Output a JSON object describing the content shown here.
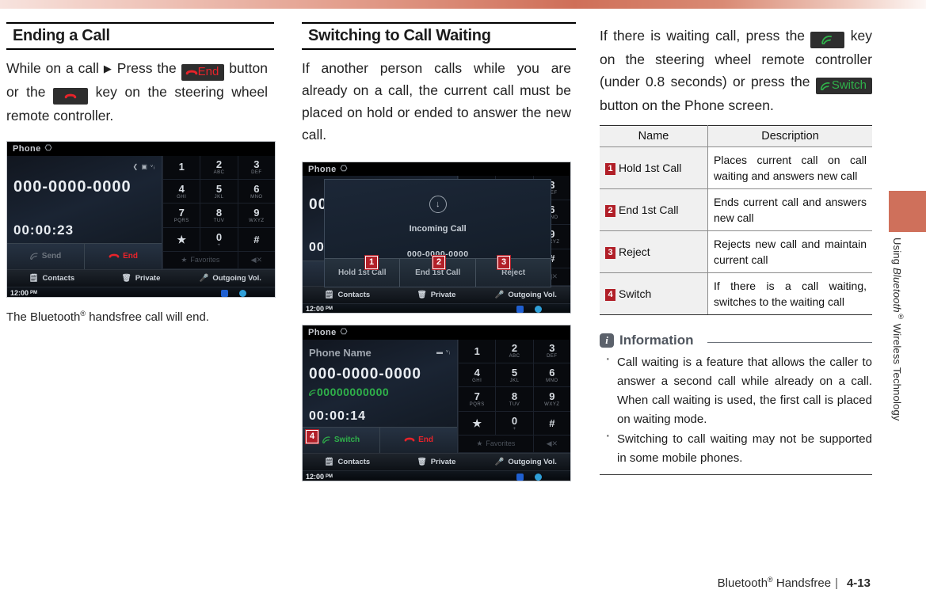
{
  "document": {
    "footer": {
      "chapter_label": "Bluetooth",
      "chapter_label_sup": "®",
      "chapter_label_rest": " Handsfree",
      "separator": "|",
      "page_number": "4-13"
    },
    "side_tab": {
      "text_before": "Using ",
      "text_italic": "Bluetooth",
      "text_sup": "®",
      "text_after": " Wireless Technology",
      "color": "#cf705b"
    }
  },
  "col1": {
    "heading": "Ending a Call",
    "instruction": {
      "part1": "While on a call",
      "arrow": "▶",
      "part2": "Press the",
      "badge_end": "End",
      "part3": "button or the",
      "part4": "key on the steering wheel remote controller."
    },
    "screenshot": {
      "title": "Phone",
      "signal": "❮ ▣ ᵛᵢ",
      "number": "000-0000-0000",
      "timer": "00:00:23",
      "action_send": "Send",
      "action_end": "End",
      "menu": [
        "Contacts",
        "Private",
        "Outgoing Vol."
      ],
      "clock": "12:00",
      "clock_ampm": "PM",
      "keypad": [
        {
          "num": "1",
          "sub": ""
        },
        {
          "num": "2",
          "sub": "ABC"
        },
        {
          "num": "3",
          "sub": "DEF"
        },
        {
          "num": "4",
          "sub": "GHI"
        },
        {
          "num": "5",
          "sub": "JKL"
        },
        {
          "num": "6",
          "sub": "MNO"
        },
        {
          "num": "7",
          "sub": "PQRS"
        },
        {
          "num": "8",
          "sub": "TUV"
        },
        {
          "num": "9",
          "sub": "WXYZ"
        },
        {
          "num": "★",
          "sub": ""
        },
        {
          "num": "0",
          "sub": "+"
        },
        {
          "num": "#",
          "sub": ""
        }
      ],
      "favorites": "Favorites",
      "delete_icon": "◀✕"
    },
    "caption": {
      "part1": "The Bluetooth",
      "sup": "®",
      "part2": " handsfree call will end."
    }
  },
  "col2": {
    "heading": "Switching to Call Waiting",
    "body": "If another person calls while you are already on a call, the current call must be placed on hold or ended to answer the new call.",
    "screenshot_incoming": {
      "title": "Phone",
      "number_partial": "000",
      "timer_partial": "00:",
      "modal_icon": "↓",
      "modal_title": "Incoming Call",
      "modal_number": "000-0000-0000",
      "modal_buttons": [
        "Hold 1st Call",
        "End 1st Call",
        "Reject"
      ],
      "callouts": [
        "1",
        "2",
        "3"
      ],
      "menu": [
        "Contacts",
        "Private",
        "Outgoing Vol."
      ],
      "clock": "12:00",
      "clock_ampm": "PM"
    },
    "screenshot_switch": {
      "title": "Phone",
      "name": "Phone Name",
      "signal": "▬ ᵛᵢ",
      "number": "000-0000-0000",
      "second_number": "00000000000",
      "timer": "00:00:14",
      "action_switch": "Switch",
      "action_end": "End",
      "callout": "4",
      "menu": [
        "Contacts",
        "Private",
        "Outgoing Vol."
      ],
      "clock": "12:00",
      "clock_ampm": "PM",
      "keypad": [
        {
          "num": "1",
          "sub": ""
        },
        {
          "num": "2",
          "sub": "ABC"
        },
        {
          "num": "3",
          "sub": "DEF"
        },
        {
          "num": "4",
          "sub": "GHI"
        },
        {
          "num": "5",
          "sub": "JKL"
        },
        {
          "num": "6",
          "sub": "MNO"
        },
        {
          "num": "7",
          "sub": "PQRS"
        },
        {
          "num": "8",
          "sub": "TUV"
        },
        {
          "num": "9",
          "sub": "WXYZ"
        },
        {
          "num": "★",
          "sub": ""
        },
        {
          "num": "0",
          "sub": "+"
        },
        {
          "num": "#",
          "sub": ""
        }
      ],
      "favorites": "Favorites",
      "delete_icon": "◀✕"
    }
  },
  "col3": {
    "body": {
      "part1": "If there is waiting call, press the",
      "part2": "key on the steering wheel remote controller (under 0.8 seconds) or press the",
      "badge_switch": "Switch",
      "part3": "button on the Phone screen."
    },
    "table": {
      "headers": [
        "Name",
        "Description"
      ],
      "rows": [
        {
          "num": "1",
          "name": "Hold 1st Call",
          "desc": "Places current call on call waiting and answers new call"
        },
        {
          "num": "2",
          "name": "End 1st Call",
          "desc": "Ends current call and answers new call"
        },
        {
          "num": "3",
          "name": "Reject",
          "desc": "Rejects new call and maintain current call"
        },
        {
          "num": "4",
          "name": "Switch",
          "desc": "If there is a call waiting, switches to the waiting call"
        }
      ]
    },
    "information": {
      "icon_letter": "i",
      "title": "Information",
      "items": [
        "Call waiting is a feature that allows the caller to answer a second call while already on a call. When call waiting is used, the first call is placed on waiting mode.",
        "Switching to call waiting may not be supported in some mobile phones."
      ]
    }
  }
}
